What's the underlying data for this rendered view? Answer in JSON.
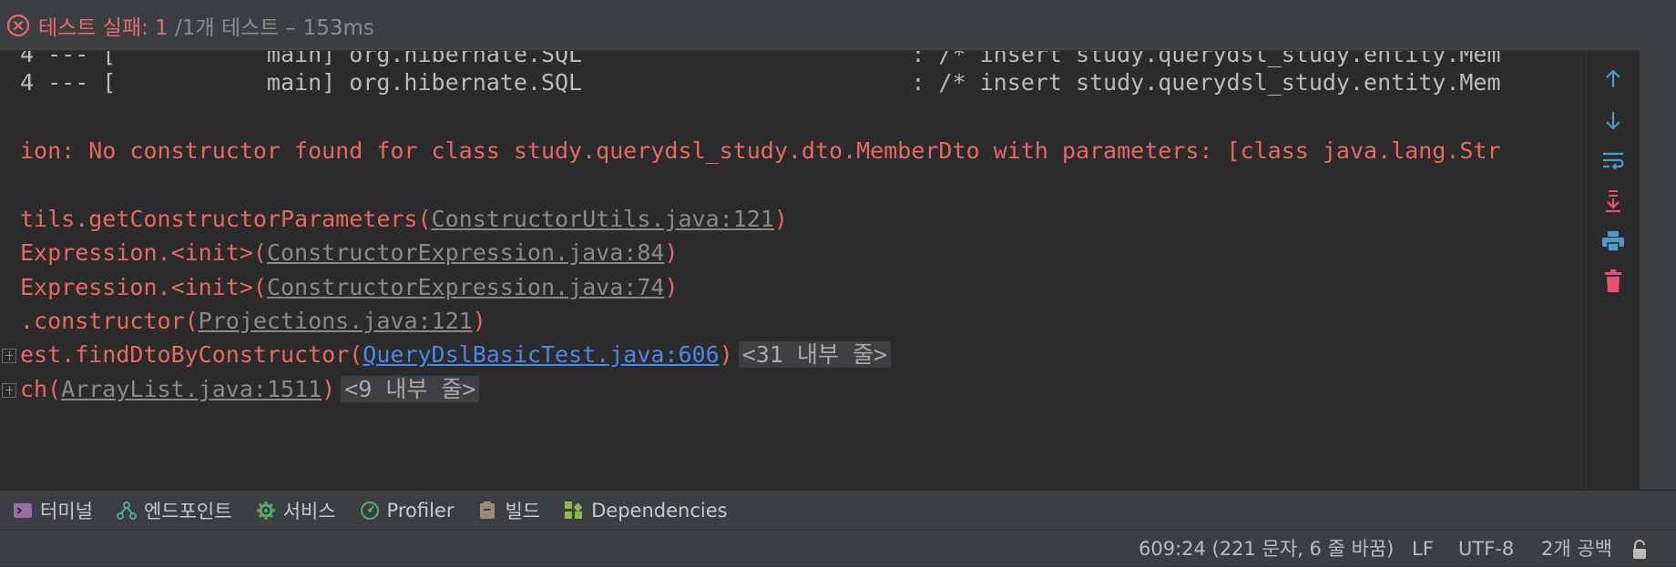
{
  "header": {
    "fail_text": "테스트 실패: 1",
    "rest_text": " /1개 테스트 – 153ms"
  },
  "console": {
    "log_lines": [
      "4 --- [           main] org.hibernate.SQL                        : /* insert study.querydsl_study.entity.Mem",
      "4 --- [           main] org.hibernate.SQL                        : /* insert study.querydsl_study.entity.Mem"
    ],
    "error_line": "ion: No constructor found for class study.querydsl_study.dto.MemberDto with parameters: [class java.lang.Str",
    "stack": [
      {
        "prefix": "tils.getConstructorParameters(",
        "link": "ConstructorUtils.java:121",
        "suffix": ")"
      },
      {
        "prefix": "Expression.<init>(",
        "link": "ConstructorExpression.java:84",
        "suffix": ")"
      },
      {
        "prefix": "Expression.<init>(",
        "link": "ConstructorExpression.java:74",
        "suffix": ")"
      },
      {
        "prefix": ".constructor(",
        "link": "Projections.java:121",
        "suffix": ")"
      },
      {
        "prefix": "est.findDtoByConstructor(",
        "link": "QueryDslBasicTest.java:606",
        "suffix": ")",
        "folded": "<31 내부 줄>"
      },
      {
        "prefix": "ch(",
        "link": "ArrayList.java:1511",
        "suffix": ")",
        "folded": "<9 내부 줄>"
      }
    ]
  },
  "tool_tabs": [
    {
      "label": "터미널",
      "icon": "terminal-icon"
    },
    {
      "label": "엔드포인트",
      "icon": "endpoints-icon"
    },
    {
      "label": "서비스",
      "icon": "services-gear-icon"
    },
    {
      "label": "Profiler",
      "icon": "profiler-icon"
    },
    {
      "label": "빌드",
      "icon": "build-icon"
    },
    {
      "label": "Dependencies",
      "icon": "dependencies-icon"
    }
  ],
  "status_bar": {
    "position": "609:24 (221 문자, 6 줄 바꿈)",
    "line_ending": "LF",
    "encoding": "UTF-8",
    "indent": "2개 공백"
  },
  "colors": {
    "error": "#e8695f",
    "link": "#4a88e8",
    "accent": "#4a9cc9",
    "toolbar_red": "#e8506d"
  }
}
